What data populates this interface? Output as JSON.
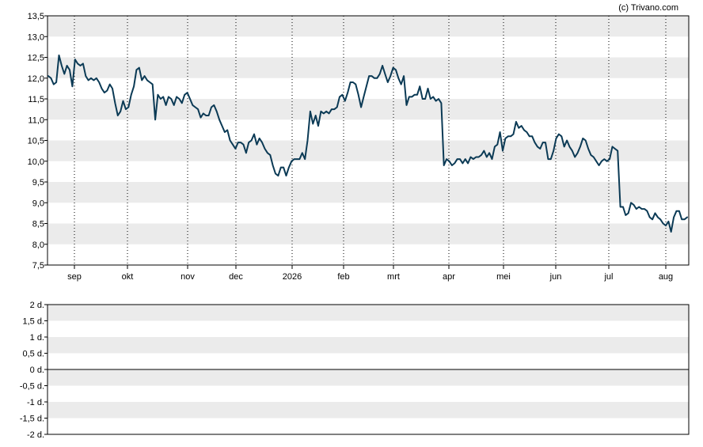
{
  "credit": "(c) Trivano.com",
  "colors": {
    "band": "#ebebeb",
    "line": "#0b3a55",
    "frame": "#000000",
    "vgrid": "#000000"
  },
  "chart_data": [
    {
      "type": "line",
      "title": "",
      "xlabel": "",
      "ylabel": "",
      "ylim": [
        7.5,
        13.5
      ],
      "yticks": [
        "13,5",
        "13,0",
        "12,5",
        "12,0",
        "11,5",
        "11,0",
        "10,5",
        "10,0",
        "9,5",
        "9,0",
        "8,5",
        "8,0",
        "7,5"
      ],
      "xticks": [
        "sep",
        "okt",
        "nov",
        "dec",
        "2026",
        "feb",
        "mrt",
        "apr",
        "mei",
        "jun",
        "jul",
        "aug"
      ],
      "grid": "vertical dotted at month ticks, alternating horizontal bands",
      "series": [
        {
          "values": [
            12.05,
            12.0,
            11.85,
            11.9,
            12.55,
            12.3,
            12.1,
            12.3,
            12.2,
            11.8,
            12.45,
            12.35,
            12.3,
            12.35,
            12.05,
            11.95,
            12.0,
            11.95,
            12.0,
            11.9,
            11.75,
            11.65,
            11.7,
            11.85,
            11.75,
            11.4,
            11.1,
            11.2,
            11.45,
            11.25,
            11.3,
            11.6,
            11.8,
            12.2,
            12.25,
            11.95,
            12.05,
            11.95,
            11.9,
            11.85,
            11.0,
            11.6,
            11.5,
            11.55,
            11.35,
            11.55,
            11.5,
            11.35,
            11.55,
            11.5,
            11.4,
            11.6,
            11.65,
            11.5,
            11.35,
            11.3,
            11.25,
            11.05,
            11.15,
            11.1,
            11.1,
            11.3,
            11.35,
            11.2,
            11.0,
            10.85,
            10.7,
            10.75,
            10.5,
            10.4,
            10.3,
            10.45,
            10.45,
            10.4,
            10.2,
            10.45,
            10.5,
            10.65,
            10.4,
            10.55,
            10.45,
            10.3,
            10.2,
            10.15,
            9.9,
            9.7,
            9.65,
            9.85,
            9.85,
            9.65,
            9.85,
            10.0,
            10.05,
            10.05,
            10.05,
            10.2,
            10.05,
            10.5,
            11.2,
            10.9,
            11.1,
            10.85,
            11.2,
            11.15,
            11.2,
            11.15,
            11.25,
            11.25,
            11.3,
            11.55,
            11.6,
            11.45,
            11.65,
            11.9,
            11.9,
            11.85,
            11.6,
            11.3,
            11.55,
            11.8,
            12.05,
            12.05,
            12.0,
            12.0,
            12.1,
            12.3,
            12.1,
            11.9,
            12.05,
            12.25,
            12.2,
            12.0,
            11.85,
            12.05,
            11.35,
            11.55,
            11.55,
            11.6,
            11.6,
            11.8,
            11.5,
            11.5,
            11.75,
            11.5,
            11.55,
            11.45,
            11.5,
            11.4,
            9.9,
            10.05,
            10.0,
            9.9,
            9.95,
            10.05,
            10.05,
            9.95,
            10.05,
            9.95,
            10.1,
            10.05,
            10.1,
            10.1,
            10.15,
            10.25,
            10.1,
            10.2,
            10.05,
            10.35,
            10.4,
            10.7,
            10.25,
            10.55,
            10.6,
            10.6,
            10.65,
            10.95,
            10.8,
            10.85,
            10.75,
            10.7,
            10.6,
            10.6,
            10.45,
            10.35,
            10.3,
            10.45,
            10.45,
            10.05,
            10.05,
            10.25,
            10.55,
            10.65,
            10.6,
            10.35,
            10.5,
            10.35,
            10.25,
            10.1,
            10.2,
            10.35,
            10.55,
            10.5,
            10.3,
            10.15,
            10.1,
            10.0,
            9.9,
            10.0,
            10.05,
            10.0,
            10.05,
            10.35,
            10.3,
            10.25,
            8.9,
            8.9,
            8.7,
            8.75,
            9.0,
            8.95,
            8.85,
            8.9,
            8.85,
            8.85,
            8.8,
            8.65,
            8.6,
            8.75,
            8.65,
            8.6,
            8.5,
            8.45,
            8.55,
            8.3,
            8.65,
            8.8,
            8.8,
            8.6,
            8.6,
            8.65
          ]
        }
      ]
    },
    {
      "type": "line",
      "title": "",
      "xlabel": "",
      "ylabel": "",
      "ylim": [
        -2,
        2
      ],
      "yticks": [
        "2 d.",
        "1,5 d.",
        "1 d.",
        "0,5 d.",
        "0 d.",
        "-0,5 d.",
        "-1 d.",
        "-1,5 d.",
        "-2 d."
      ],
      "grid": "alternating horizontal bands",
      "series": []
    }
  ]
}
